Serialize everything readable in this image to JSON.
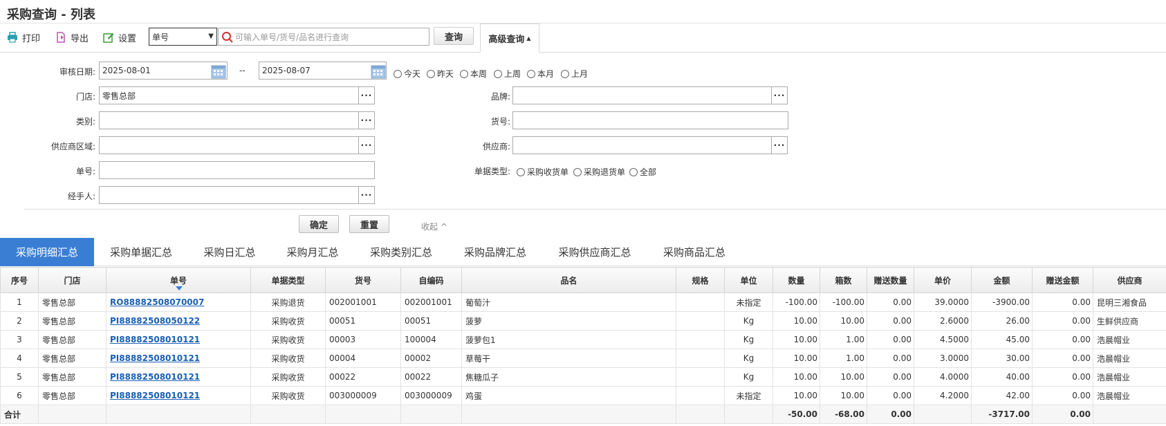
{
  "title": "采购查询 - 列表",
  "toolbar": {
    "print_label": "打印",
    "export_label": "导出",
    "settings_label": "设置",
    "select_value": "单号",
    "search_placeholder": "可输入单号/货号/品名进行查询",
    "query_label": "查询",
    "advanced_label": "高级查询"
  },
  "filters": {
    "date_label": "审核日期:",
    "date_from": "2025-08-01",
    "date_sep": "--",
    "date_to": "2025-08-07",
    "quick_dates": [
      "今天",
      "昨天",
      "本周",
      "上周",
      "本月",
      "上月"
    ],
    "store_label": "门店:",
    "store_value": "零售总部",
    "brand_label": "品牌:",
    "category_label": "类别:",
    "item_no_label": "货号:",
    "supplier_region_label": "供应商区域:",
    "supplier_label": "供应商:",
    "order_no_label": "单号:",
    "doc_type_label": "单据类型:",
    "doc_types": [
      "采购收货单",
      "采购退货单",
      "全部"
    ],
    "handler_label": "经手人:",
    "confirm_label": "确定",
    "reset_label": "重置",
    "collapse_label": "收起"
  },
  "tabs": [
    "采购明细汇总",
    "采购单据汇总",
    "采购日汇总",
    "采购月汇总",
    "采购类别汇总",
    "采购品牌汇总",
    "采购供应商汇总",
    "采购商品汇总"
  ],
  "table": {
    "headers": [
      "序号",
      "门店",
      "单号",
      "单据类型",
      "货号",
      "自编码",
      "品名",
      "规格",
      "单位",
      "数量",
      "箱数",
      "赠送数量",
      "单价",
      "金额",
      "赠送金额",
      "供应商"
    ],
    "rows": [
      [
        "1",
        "零售总部",
        "RO88882508070007",
        "采购退货",
        "002001001",
        "002001001",
        "葡萄汁",
        "",
        "未指定",
        "-100.00",
        "-100.00",
        "0.00",
        "39.0000",
        "-3900.00",
        "0.00",
        "昆明三湘食品"
      ],
      [
        "2",
        "零售总部",
        "PI88882508050122",
        "采购收货",
        "00051",
        "00051",
        "菠萝",
        "",
        "Kg",
        "10.00",
        "10.00",
        "0.00",
        "2.6000",
        "26.00",
        "0.00",
        "生鲜供应商"
      ],
      [
        "3",
        "零售总部",
        "PI88882508010121",
        "采购收货",
        "00003",
        "100004",
        "菠萝包1",
        "",
        "Kg",
        "10.00",
        "1.00",
        "0.00",
        "4.5000",
        "45.00",
        "0.00",
        "浩晨帽业"
      ],
      [
        "4",
        "零售总部",
        "PI88882508010121",
        "采购收货",
        "00004",
        "00002",
        "草莓干",
        "",
        "Kg",
        "10.00",
        "1.00",
        "0.00",
        "3.0000",
        "30.00",
        "0.00",
        "浩晨帽业"
      ],
      [
        "5",
        "零售总部",
        "PI88882508010121",
        "采购收货",
        "00022",
        "00022",
        "焦糖瓜子",
        "",
        "Kg",
        "10.00",
        "10.00",
        "0.00",
        "4.0000",
        "40.00",
        "0.00",
        "浩晨帽业"
      ],
      [
        "6",
        "零售总部",
        "PI88882508010121",
        "采购收货",
        "003000009",
        "003000009",
        "鸡蛋",
        "",
        "未指定",
        "10.00",
        "10.00",
        "0.00",
        "4.2000",
        "42.00",
        "0.00",
        "浩晨帽业"
      ]
    ],
    "total": {
      "label": "合计",
      "qty": "-50.00",
      "boxes": "-68.00",
      "gift_qty": "0.00",
      "amount": "-3717.00",
      "gift_amount": "0.00"
    }
  },
  "colors": {
    "accent": "#3a7ed4",
    "link": "#1a5fb4"
  }
}
